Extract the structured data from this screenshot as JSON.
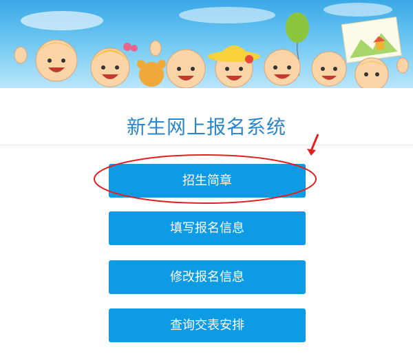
{
  "header": {
    "title": "新生网上报名系统"
  },
  "menu": {
    "items": [
      {
        "label": "招生简章"
      },
      {
        "label": "填写报名信息"
      },
      {
        "label": "修改报名信息"
      },
      {
        "label": "查询交表安排"
      }
    ]
  },
  "annotation": {
    "highlighted_item": "招生简章",
    "color": "#e02020"
  },
  "colors": {
    "button": "#0e9be6",
    "title": "#2a86c8",
    "banner_sky": "#5bbcef"
  }
}
